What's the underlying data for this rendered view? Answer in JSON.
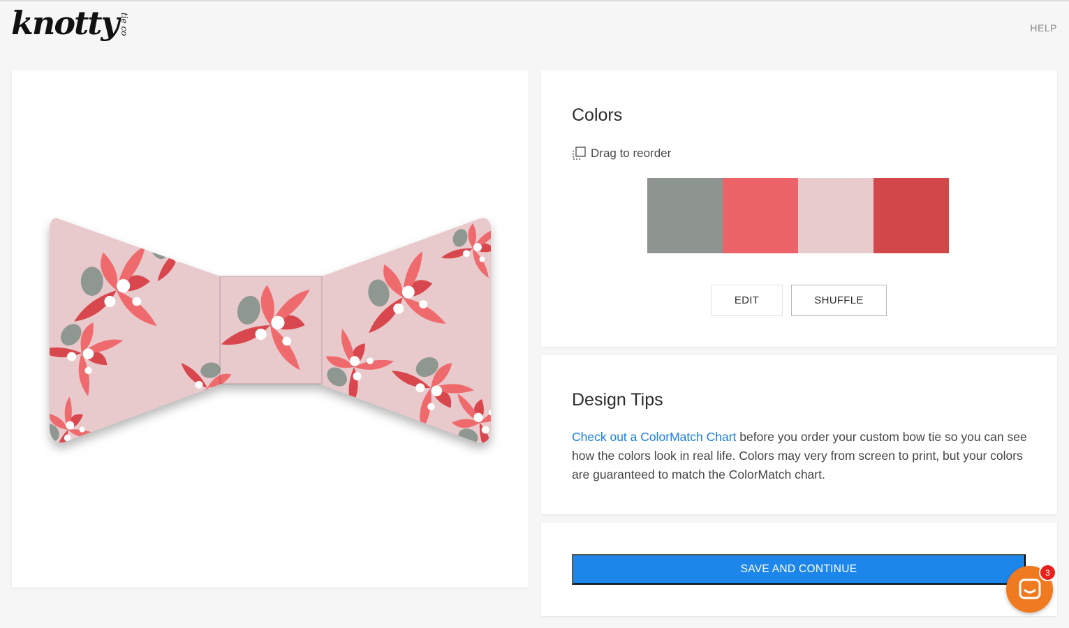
{
  "header": {
    "logo_text": "knotty",
    "logo_sub": "tie co",
    "help_label": "HELP"
  },
  "preview": {
    "pattern_colors": {
      "background": "#e8c9cc",
      "leaf_red": "#d8474d",
      "leaf_coral": "#ee6a6d",
      "leaf_gray": "#8e9790",
      "flower": "#ffffff"
    }
  },
  "colors": {
    "title": "Colors",
    "drag_label": "Drag to reorder",
    "swatches": [
      "#8e9590",
      "#ec6467",
      "#e8cbcc",
      "#d2474a"
    ],
    "edit_label": "EDIT",
    "shuffle_label": "SHUFFLE"
  },
  "tips": {
    "title": "Design Tips",
    "link_text": "Check out a ColorMatch Chart",
    "body_text": " before you order your custom bow tie so you can see how the colors look in real life. Colors may very from screen to print, but your colors are guaranteed to match the ColorMatch chart."
  },
  "actions": {
    "save_label": "SAVE AND CONTINUE"
  },
  "chat": {
    "badge_count": "3",
    "accent": "#f07a1f"
  }
}
